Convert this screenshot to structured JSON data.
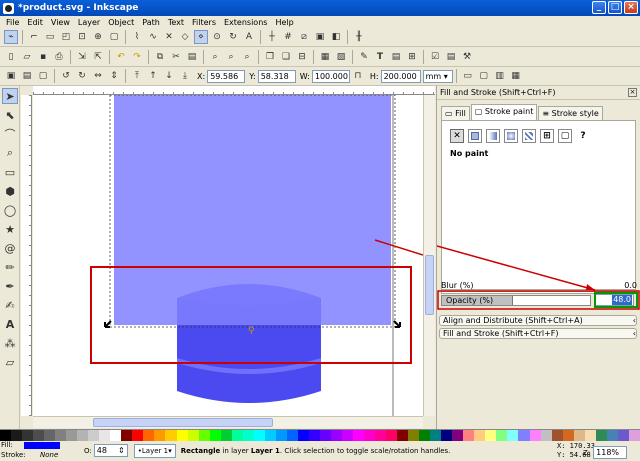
{
  "window": {
    "title": "*product.svg - Inkscape"
  },
  "menu": [
    "File",
    "Edit",
    "View",
    "Layer",
    "Object",
    "Path",
    "Text",
    "Filters",
    "Extensions",
    "Help"
  ],
  "toolcontrols": {
    "x_label": "X:",
    "x_value": "59.586",
    "y_label": "Y:",
    "y_value": "58.318",
    "w_label": "W:",
    "w_value": "100.000",
    "h_label": "H:",
    "h_value": "200.000",
    "unit": "mm"
  },
  "dock": {
    "title": "Fill and Stroke (Shift+Ctrl+F)",
    "tabs": [
      "Fill",
      "Stroke paint",
      "Stroke style"
    ],
    "paint_status": "No paint",
    "blur_label": "Blur (%)",
    "blur_value": "0.0",
    "opacity_label": "Opacity (%)",
    "opacity_value": "48.0",
    "opacity_fraction": 0.48,
    "collapsed1": "Align and Distribute (Shift+Ctrl+A)",
    "collapsed2": "Fill and Stroke (Shift+Ctrl+F)"
  },
  "statusbar": {
    "fill_label": "Fill:",
    "stroke_label": "Stroke:",
    "stroke_value": "None",
    "o_label": "O:",
    "o_value": "48",
    "layer": "•Layer 1",
    "message_strong": "Rectangle",
    "message_rest": " in layer ",
    "message_layer": "Layer 1",
    "message_end": ". Click selection to toggle scale/rotation handles.",
    "x_coord": "X: 170.33",
    "y_coord": "Y:  54.68",
    "zoom_label": "Z:",
    "zoom_value": "118%"
  },
  "colors": {
    "fill": "#0000ff",
    "selected_rect": "#8080ff",
    "product_body": "#4a4af0",
    "annotation": "#cc0000",
    "highlight": "#009900"
  },
  "palette": [
    "#000000",
    "#1a1a1a",
    "#333333",
    "#4d4d4d",
    "#666666",
    "#808080",
    "#999999",
    "#b3b3b3",
    "#cccccc",
    "#e6e6e6",
    "#ffffff",
    "#800000",
    "#ff0000",
    "#ff6600",
    "#ff9900",
    "#ffcc00",
    "#ffff00",
    "#ccff00",
    "#66ff00",
    "#00ff00",
    "#00cc33",
    "#00ff99",
    "#00ffcc",
    "#00ffff",
    "#00ccff",
    "#0099ff",
    "#0066ff",
    "#0000ff",
    "#3300ff",
    "#6600ff",
    "#9900ff",
    "#cc00ff",
    "#ff00ff",
    "#ff00cc",
    "#ff0099",
    "#ff0066",
    "#800000",
    "#808000",
    "#008000",
    "#008080",
    "#000080",
    "#800080",
    "#ff8080",
    "#ffcc80",
    "#ffff80",
    "#80ff80",
    "#80ffff",
    "#8080ff",
    "#ff80ff",
    "#c0c0c0",
    "#a0522d",
    "#d2691e",
    "#deb887",
    "#f5deb3",
    "#2e8b57",
    "#4682b4",
    "#6a5acd",
    "#dda0dd"
  ]
}
